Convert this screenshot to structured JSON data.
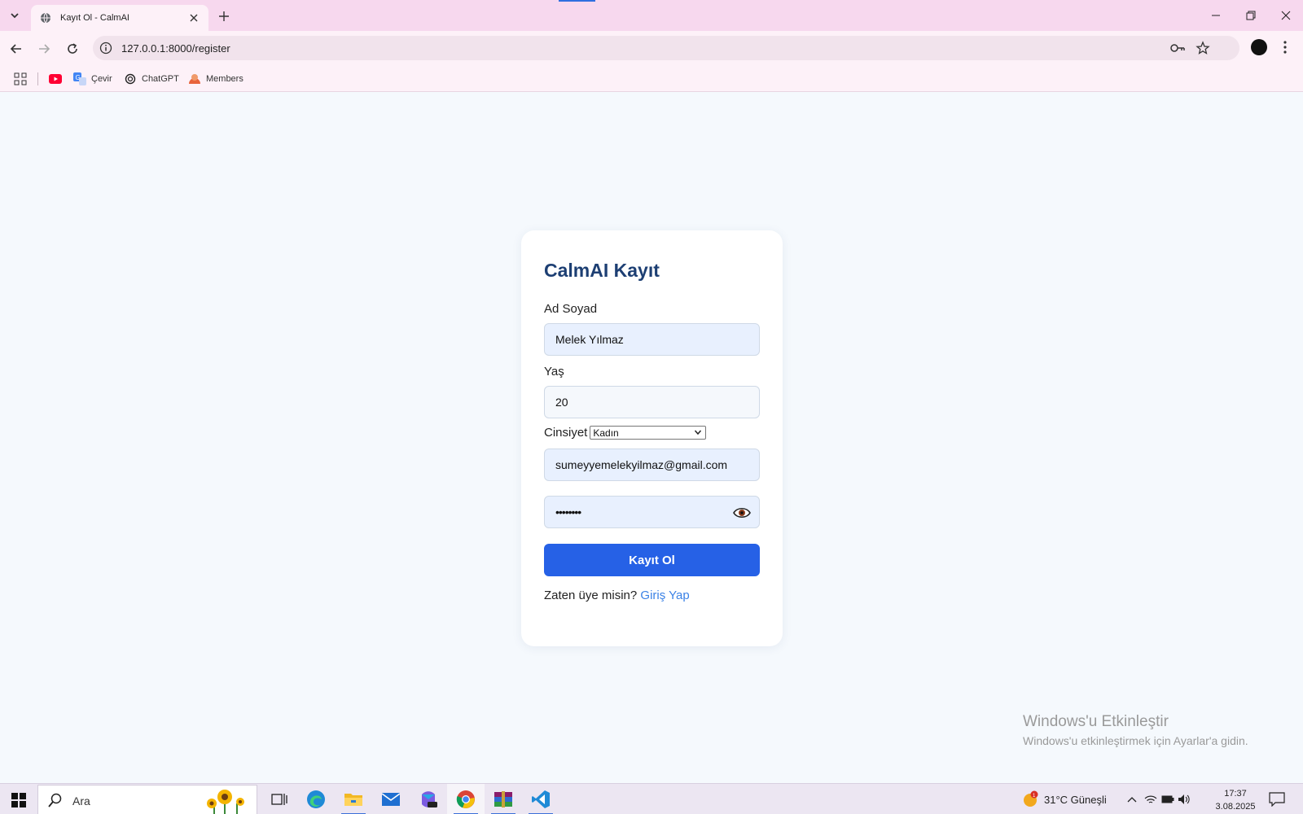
{
  "browser": {
    "tab_title": "Kayıt Ol - CalmAI",
    "url": "127.0.0.1:8000/register",
    "bookmarks": [
      "Çevir",
      "ChatGPT",
      "Members"
    ]
  },
  "form": {
    "title": "CalmAI Kayıt",
    "name_label": "Ad Soyad",
    "name_value": "Melek Yılmaz",
    "age_label": "Yaş",
    "age_value": "20",
    "gender_label": "Cinsiyet",
    "gender_value": "Kadın",
    "email_value": "sumeyyemelekyilmaz@gmail.com",
    "password_value": "••••••••",
    "submit_label": "Kayıt Ol",
    "login_prompt": "Zaten üye misin?",
    "login_link": "Giriş Yap"
  },
  "watermark": {
    "line1": "Windows'u Etkinleştir",
    "line2": "Windows'u etkinleştirmek için Ayarlar'a gidin."
  },
  "taskbar": {
    "search_placeholder": "Ara",
    "weather": "31°C  Güneşli",
    "time": "17:37",
    "date": "3.08.2025"
  },
  "colors": {
    "title": "#1d3f73",
    "button": "#2661e6",
    "link": "#3b82e6"
  }
}
